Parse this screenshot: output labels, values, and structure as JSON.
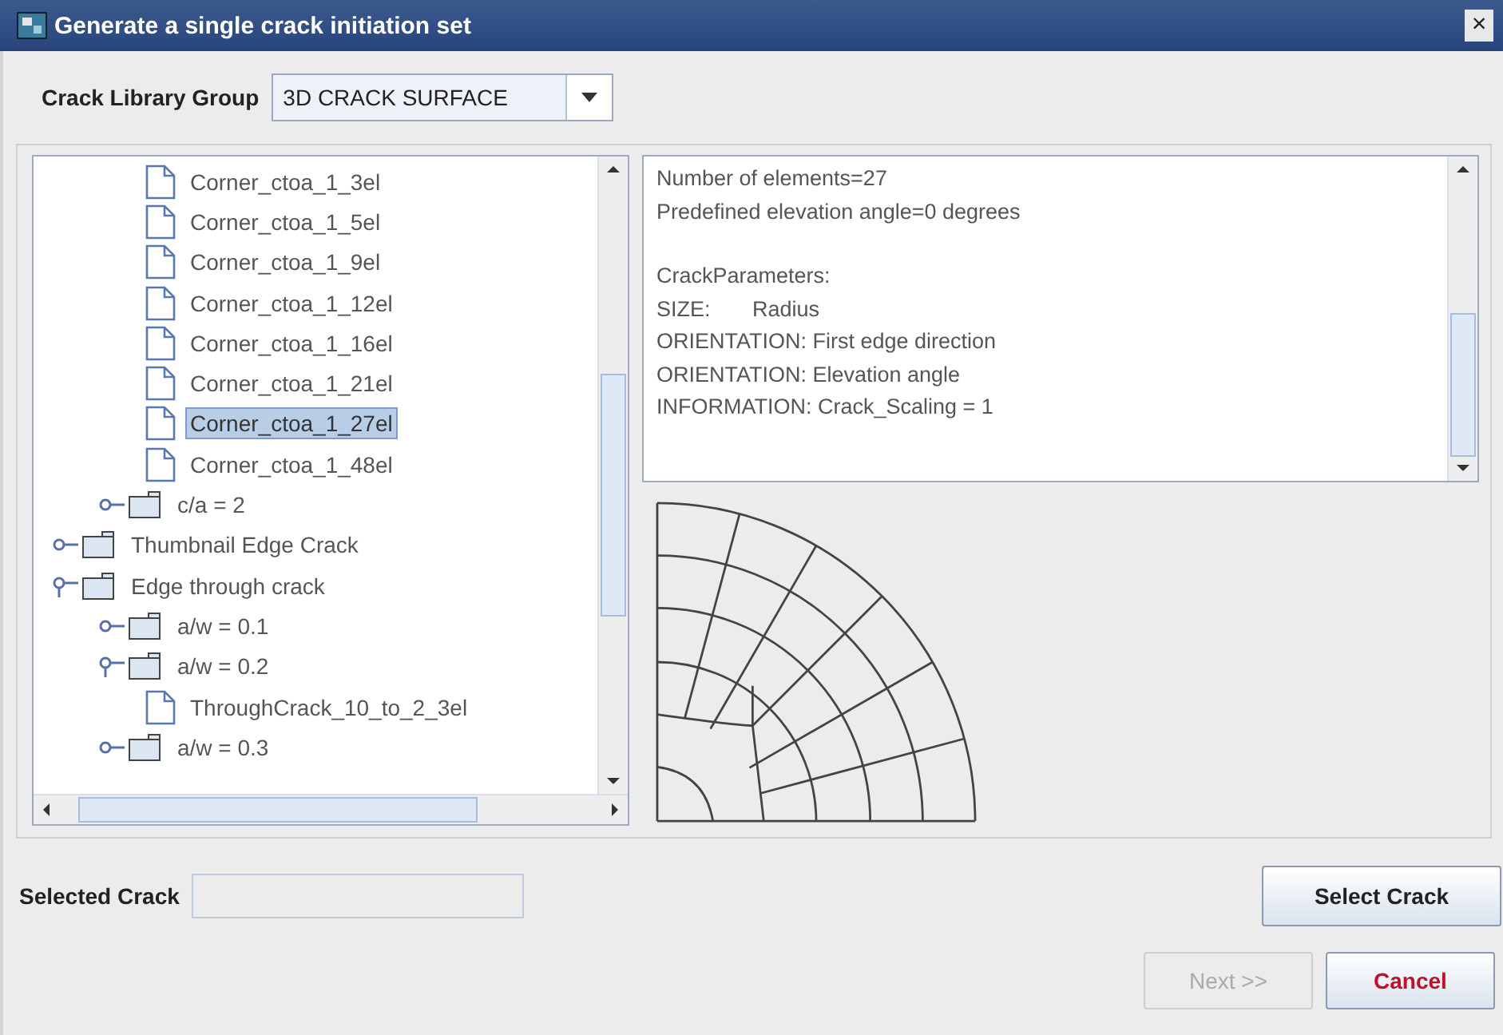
{
  "window": {
    "title": "Generate a single crack initiation set",
    "close": "×"
  },
  "library_group": {
    "label": "Crack Library Group",
    "value": "3D CRACK SURFACE"
  },
  "tree": {
    "items": [
      {
        "kind": "folder",
        "children": [
          {
            "kind": "folder",
            "children": [
              {
                "kind": "file",
                "label": "Corner_ctoa_1_3el",
                "selected": false
              },
              {
                "kind": "file",
                "label": "Corner_ctoa_1_5el",
                "selected": false
              },
              {
                "kind": "file",
                "label": "Corner_ctoa_1_9el",
                "selected": false
              },
              {
                "kind": "file",
                "label": "Corner_ctoa_1_12el",
                "selected": false
              },
              {
                "kind": "file",
                "label": "Corner_ctoa_1_16el",
                "selected": false
              },
              {
                "kind": "file",
                "label": "Corner_ctoa_1_21el",
                "selected": false
              },
              {
                "kind": "file",
                "label": "Corner_ctoa_1_27el",
                "selected": true
              },
              {
                "kind": "file",
                "label": "Corner_ctoa_1_48el",
                "selected": false
              }
            ]
          },
          {
            "kind": "folder",
            "label": "c/a = 2",
            "expanded": false
          }
        ]
      },
      {
        "kind": "folder",
        "label": "Thumbnail Edge Crack",
        "expanded": false
      },
      {
        "kind": "folder",
        "label": "Edge through crack",
        "expanded": true,
        "children": [
          {
            "kind": "folder",
            "label": "a/w = 0.1",
            "expanded": false
          },
          {
            "kind": "folder",
            "label": "a/w = 0.2",
            "expanded": true,
            "children": [
              {
                "kind": "file",
                "label": "ThroughCrack_10_to_2_3el",
                "selected": false
              }
            ]
          },
          {
            "kind": "folder",
            "label": "a/w = 0.3",
            "expanded": false
          }
        ]
      }
    ]
  },
  "details": {
    "paragraphs": [
      [
        "Number of elements=27",
        "Predefined elevation angle=0 degrees"
      ],
      [
        "CrackParameters:",
        "SIZE:       Radius",
        "ORIENTATION: First edge direction",
        "ORIENTATION: Elevation angle",
        "INFORMATION: Crack_Scaling = 1"
      ]
    ]
  },
  "selected_crack": {
    "label": "Selected Crack"
  },
  "buttons": [
    {
      "label": "Select Crack",
      "kind": "select",
      "disabled": false
    },
    {
      "label": "Next >>",
      "kind": "next",
      "disabled": true
    },
    {
      "label": "Cancel",
      "kind": "cancel",
      "disabled": false
    }
  ]
}
